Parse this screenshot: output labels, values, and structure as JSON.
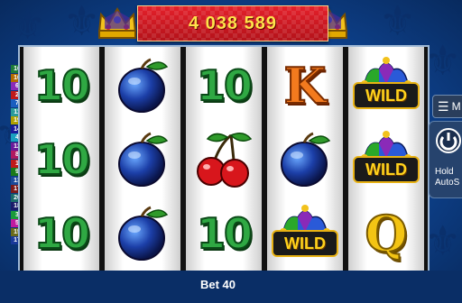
{
  "banner": {
    "value": "4 038 589"
  },
  "bet": {
    "label": "Bet 40"
  },
  "controls": {
    "menu_label": "M",
    "hold_line1": "Hold",
    "hold_line2": "AutoS"
  },
  "colors": {
    "background": "#0d3f88",
    "banner_red": "#d01a22",
    "banner_text": "#ffe24a",
    "ten_green": "#2fa843",
    "k_orange": "#f37a1e",
    "q_yellow": "#f3c414"
  },
  "reels": [
    {
      "symbols": [
        {
          "type": "text",
          "value": "10"
        },
        {
          "type": "text",
          "value": "10"
        },
        {
          "type": "text",
          "value": "10"
        }
      ]
    },
    {
      "symbols": [
        {
          "type": "icon",
          "icon": "plum-icon"
        },
        {
          "type": "icon",
          "icon": "plum-icon"
        },
        {
          "type": "icon",
          "icon": "plum-icon"
        }
      ]
    },
    {
      "symbols": [
        {
          "type": "text",
          "value": "10"
        },
        {
          "type": "icon",
          "icon": "cherries-icon"
        },
        {
          "type": "text",
          "value": "10"
        }
      ]
    },
    {
      "symbols": [
        {
          "type": "text",
          "value": "K"
        },
        {
          "type": "icon",
          "icon": "plum-icon"
        },
        {
          "type": "wild",
          "value": "WILD"
        }
      ]
    },
    {
      "symbols": [
        {
          "type": "wild",
          "value": "WILD"
        },
        {
          "type": "wild",
          "value": "WILD"
        },
        {
          "type": "text",
          "value": "Q"
        }
      ]
    }
  ],
  "paylines": {
    "left": [
      {
        "n": "16",
        "c": "#1d7a3a"
      },
      {
        "n": "10",
        "c": "#b36a00"
      },
      {
        "n": "6",
        "c": "#8a2bb8"
      },
      {
        "n": "2",
        "c": "#c01a1a"
      },
      {
        "n": "7",
        "c": "#1a5ec0"
      },
      {
        "n": "11",
        "c": "#2a9a9a"
      },
      {
        "n": "19",
        "c": "#b0a000"
      },
      {
        "n": "14",
        "c": "#1a1a9a"
      },
      {
        "n": "4",
        "c": "#1aa0c0"
      },
      {
        "n": "12",
        "c": "#6a1a9a"
      },
      {
        "n": "8",
        "c": "#b01a60"
      },
      {
        "n": "1",
        "c": "#c01a1a"
      },
      {
        "n": "9",
        "c": "#1a7a1a"
      },
      {
        "n": "13",
        "c": "#1a4a9a"
      },
      {
        "n": "17",
        "c": "#7a1a1a"
      },
      {
        "n": "20",
        "c": "#1a6a6a"
      },
      {
        "n": "18",
        "c": "#1a1a6a"
      },
      {
        "n": "3",
        "c": "#1a9a3a"
      },
      {
        "n": "5",
        "c": "#c01aa0"
      },
      {
        "n": "15",
        "c": "#6a6a1a"
      },
      {
        "n": "17",
        "c": "#1a3a9a"
      }
    ]
  }
}
